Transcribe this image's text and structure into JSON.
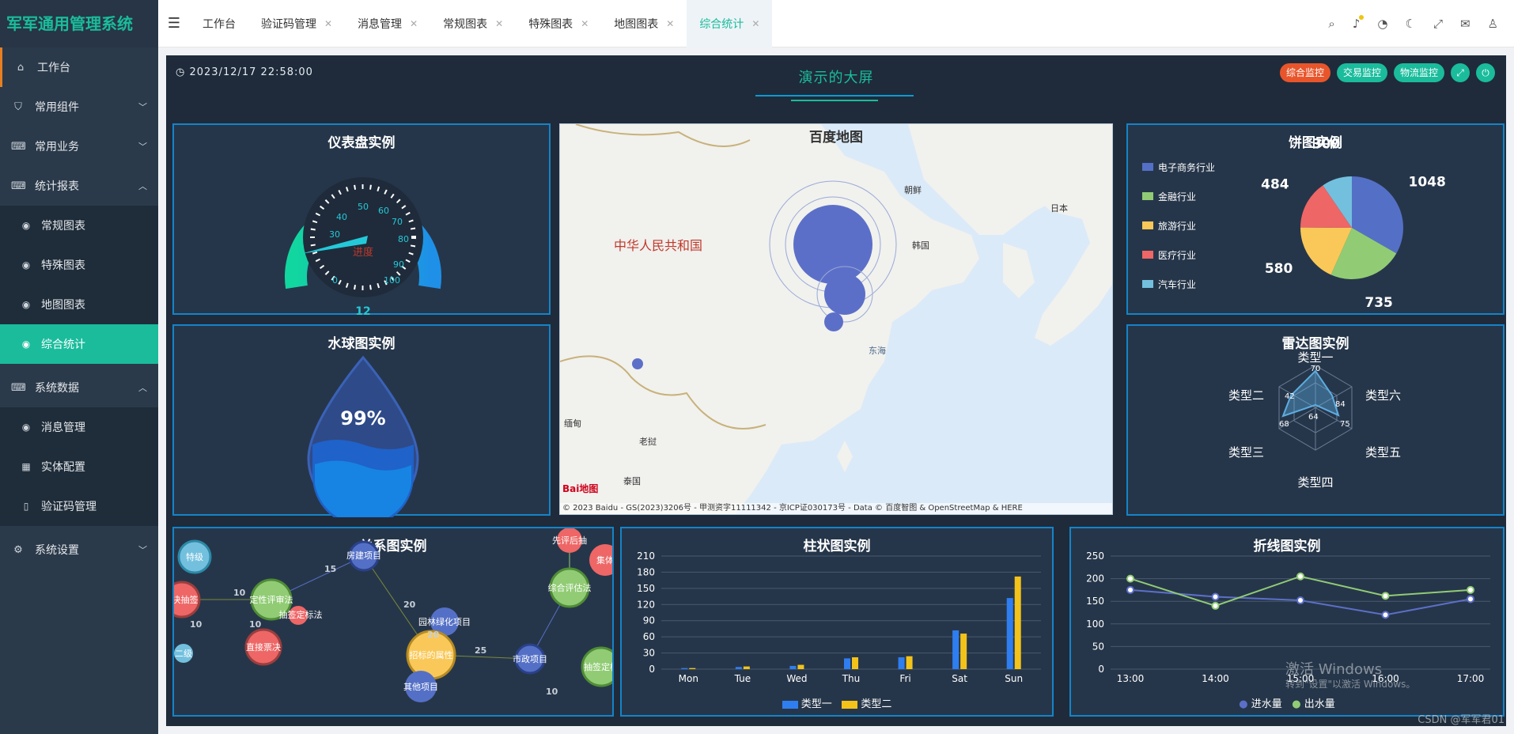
{
  "app": {
    "brand": "军军通用管理系统"
  },
  "sidebar": {
    "items": [
      {
        "icon": "home-icon",
        "label": "工作台"
      },
      {
        "icon": "shield-icon",
        "label": "常用组件"
      },
      {
        "icon": "keyboard-icon",
        "label": "常用业务"
      },
      {
        "icon": "keyboard-icon",
        "label": "统计报表"
      }
    ],
    "report_sub": [
      {
        "icon": "eye-icon",
        "label": "常规图表"
      },
      {
        "icon": "eye-icon",
        "label": "特殊图表"
      },
      {
        "icon": "eye-icon",
        "label": "地图图表"
      },
      {
        "icon": "eye-icon",
        "label": "综合统计"
      }
    ],
    "system_data": {
      "icon": "keyboard-icon",
      "label": "系统数据"
    },
    "system_sub": [
      {
        "icon": "eye-icon",
        "label": "消息管理"
      },
      {
        "icon": "grid-icon",
        "label": "实体配置"
      },
      {
        "icon": "phone-icon",
        "label": "验证码管理"
      }
    ],
    "settings": {
      "icon": "gear-icon",
      "label": "系统设置"
    }
  },
  "header": {
    "tabs": [
      {
        "label": "工作台",
        "closable": false
      },
      {
        "label": "验证码管理",
        "closable": true
      },
      {
        "label": "消息管理",
        "closable": true
      },
      {
        "label": "常规图表",
        "closable": true
      },
      {
        "label": "特殊图表",
        "closable": true
      },
      {
        "label": "地图图表",
        "closable": true
      },
      {
        "label": "综合统计",
        "closable": true
      }
    ]
  },
  "dashboard": {
    "datetime": "2023/12/17 22:58:00",
    "title": "演示的大屏",
    "buttons": [
      {
        "label": "综合监控",
        "color": "#e8552b"
      },
      {
        "label": "交易监控",
        "color": "#1abc9c"
      },
      {
        "label": "物流监控",
        "color": "#1abc9c"
      }
    ],
    "gauge": {
      "title": "仪表盘实例",
      "label": "进度",
      "value_text": "12",
      "ticks": [
        "0",
        "10",
        "20",
        "30",
        "40",
        "50",
        "60",
        "70",
        "80",
        "90",
        "100"
      ]
    },
    "liquid": {
      "title": "水球图实例",
      "percent": "99%"
    },
    "map": {
      "title": "百度地图",
      "labels": {
        "china": "中华人民共和国",
        "japan": "日本",
        "korea": "韩国",
        "north_korea": "朝鲜",
        "myanmar": "缅甸",
        "laos": "老挝",
        "thailand": "泰国",
        "east_sea": "东海"
      },
      "copyright": "© 2023 Baidu - GS(2023)3206号 - 甲测资字11111342 - 京ICP证030173号 - Data © 百度智图 & OpenStreetMap & HERE",
      "logo": "Bai地图"
    },
    "pie": {
      "title": "饼图实例",
      "legend": [
        "电子商务行业",
        "金融行业",
        "旅游行业",
        "医疗行业",
        "汽车行业"
      ],
      "values_shown": [
        "1048",
        "735",
        "580",
        "484",
        "300"
      ]
    },
    "radar": {
      "title": "雷达图实例",
      "axes": [
        "类型一",
        "类型六",
        "类型五",
        "类型四",
        "类型三",
        "类型二"
      ],
      "values_text": [
        "70",
        "84",
        "75",
        "64",
        "68",
        "42"
      ]
    },
    "relation": {
      "title": "关系图实例",
      "nodes": [
        "特级",
        "决抽签",
        "定性评审法",
        "抽签定标法",
        "直接票决",
        "二级",
        "房建项目",
        "园林绿化项目",
        "招标的属性",
        "其他项目",
        "市政项目",
        "先评后抽",
        "集体",
        "综合评估法",
        "抽签定标"
      ],
      "edge_labels": [
        "10",
        "15",
        "10",
        "20",
        "20",
        "10",
        "25",
        "10"
      ]
    },
    "bar": {
      "title": "柱状图实例",
      "legend": [
        "类型一",
        "类型二"
      ]
    },
    "line": {
      "title": "折线图实例",
      "legend": [
        "进水量",
        "出水量"
      ]
    }
  },
  "watermark": {
    "line1": "激活 Windows",
    "line2": "转到\"设置\"以激活 Windows。"
  },
  "csdn": "CSDN @军军君01",
  "chart_data": [
    {
      "type": "bar",
      "title": "柱状图实例",
      "categories": [
        "Mon",
        "Tue",
        "Wed",
        "Thu",
        "Fri",
        "Sat",
        "Sun"
      ],
      "series": [
        {
          "name": "类型一",
          "values": [
            2,
            4,
            6,
            20,
            22,
            72,
            132
          ]
        },
        {
          "name": "类型二",
          "values": [
            2,
            5,
            8,
            22,
            24,
            66,
            172
          ]
        }
      ],
      "ylim": [
        0,
        210
      ],
      "yticks": [
        0,
        30,
        60,
        90,
        120,
        150,
        180,
        210
      ]
    },
    {
      "type": "line",
      "title": "折线图实例",
      "x": [
        "13:00",
        "14:00",
        "15:00",
        "16:00",
        "17:00"
      ],
      "series": [
        {
          "name": "进水量",
          "values": [
            175,
            160,
            152,
            120,
            155
          ]
        },
        {
          "name": "出水量",
          "values": [
            200,
            140,
            205,
            162,
            175
          ]
        }
      ],
      "ylim": [
        0,
        250
      ],
      "yticks": [
        0,
        50,
        100,
        150,
        200,
        250
      ]
    },
    {
      "type": "pie",
      "title": "饼图实例",
      "categories": [
        "电子商务行业",
        "金融行业",
        "旅游行业",
        "医疗行业",
        "汽车行业"
      ],
      "values": [
        1048,
        735,
        580,
        484,
        300
      ],
      "colors": [
        "#5470c6",
        "#91cc75",
        "#fac858",
        "#ee6666",
        "#73c0de"
      ]
    }
  ]
}
